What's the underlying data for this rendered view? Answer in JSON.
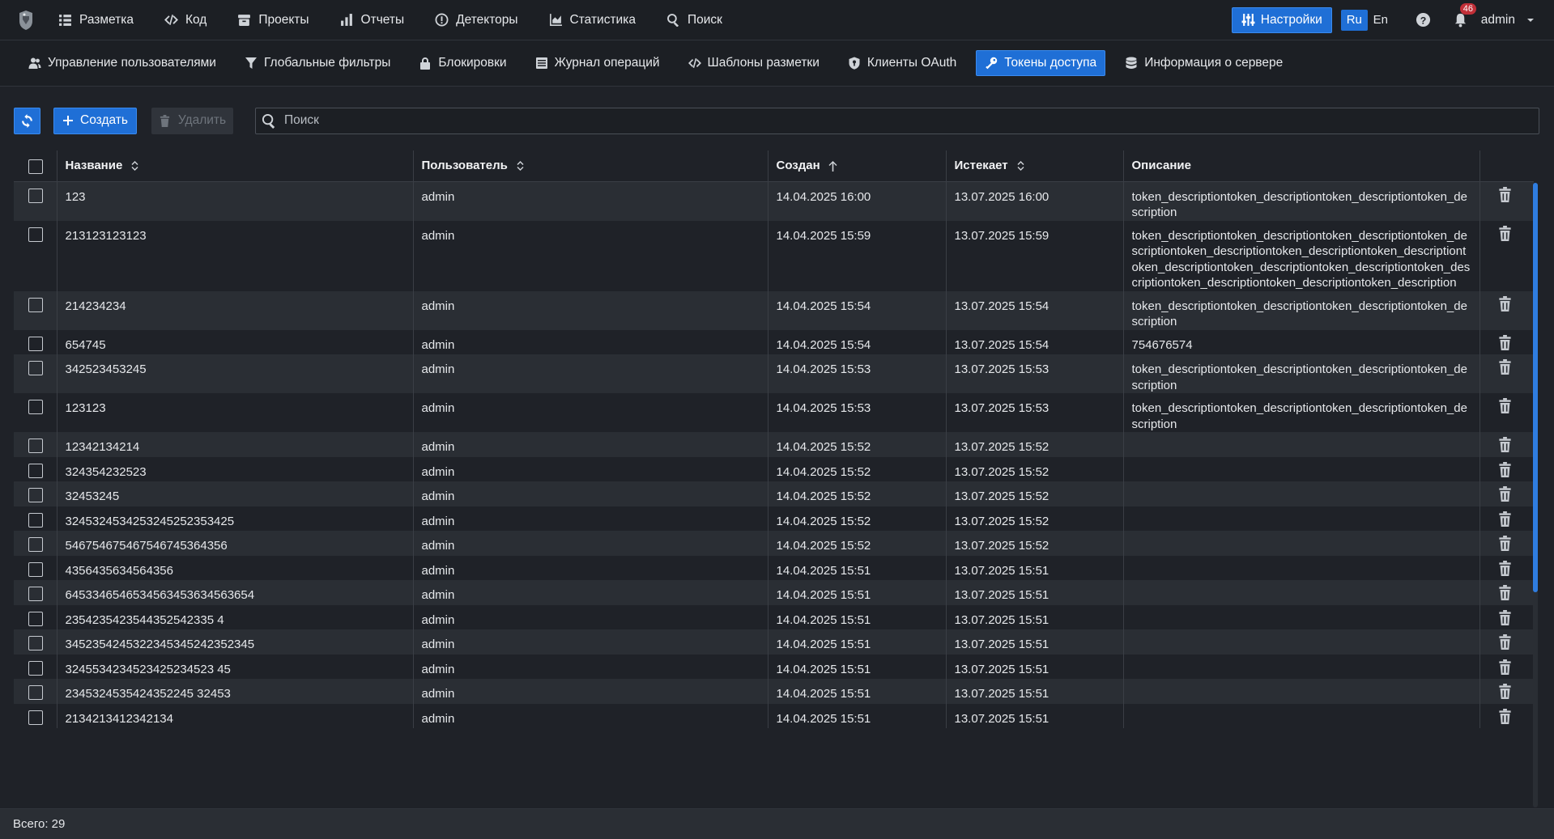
{
  "topnav": {
    "items": [
      {
        "label": "Разметка",
        "icon": "list-icon"
      },
      {
        "label": "Код",
        "icon": "code-icon"
      },
      {
        "label": "Проекты",
        "icon": "archive-icon"
      },
      {
        "label": "Отчеты",
        "icon": "chart-icon"
      },
      {
        "label": "Детекторы",
        "icon": "alert-circle-icon"
      },
      {
        "label": "Статистика",
        "icon": "area-chart-icon"
      },
      {
        "label": "Поиск",
        "icon": "search-icon"
      }
    ],
    "settings_label": "Настройки",
    "lang_ru": "Ru",
    "lang_en": "En",
    "notifications_count": "46",
    "user": "admin"
  },
  "subnav": {
    "items": [
      {
        "label": "Управление пользователями",
        "icon": "users-icon"
      },
      {
        "label": "Глобальные фильтры",
        "icon": "filter-icon"
      },
      {
        "label": "Блокировки",
        "icon": "lock-icon"
      },
      {
        "label": "Журнал операций",
        "icon": "journal-icon"
      },
      {
        "label": "Шаблоны разметки",
        "icon": "code-icon"
      },
      {
        "label": "Клиенты OAuth",
        "icon": "shield-icon"
      },
      {
        "label": "Токены доступа",
        "icon": "key-icon",
        "active": true
      },
      {
        "label": "Информация о сервере",
        "icon": "database-icon"
      }
    ]
  },
  "toolbar": {
    "create_label": "Создать",
    "delete_label": "Удалить",
    "search_placeholder": "Поиск"
  },
  "table": {
    "headers": {
      "name": "Название",
      "user": "Пользователь",
      "created": "Создан",
      "expires": "Истекает",
      "description": "Описание"
    },
    "rows": [
      {
        "name": "123",
        "user": "admin",
        "created": "14.04.2025 16:00",
        "expires": "13.07.2025 16:00",
        "description": "token_descriptiontoken_descriptiontoken_descriptiontoken_description"
      },
      {
        "name": "213123123123",
        "user": "admin",
        "created": "14.04.2025 15:59",
        "expires": "13.07.2025 15:59",
        "description": "token_descriptiontoken_descriptiontoken_descriptiontoken_descriptiontoken_descriptiontoken_descriptiontoken_descriptiontoken_descriptiontoken_descriptiontoken_descriptiontoken_descriptiontoken_descriptiontoken_descriptiontoken_description"
      },
      {
        "name": "214234234",
        "user": "admin",
        "created": "14.04.2025 15:54",
        "expires": "13.07.2025 15:54",
        "description": "token_descriptiontoken_descriptiontoken_descriptiontoken_description"
      },
      {
        "name": "654745",
        "user": "admin",
        "created": "14.04.2025 15:54",
        "expires": "13.07.2025 15:54",
        "description": "754676574"
      },
      {
        "name": "342523453245",
        "user": "admin",
        "created": "14.04.2025 15:53",
        "expires": "13.07.2025 15:53",
        "description": "token_descriptiontoken_descriptiontoken_descriptiontoken_description"
      },
      {
        "name": "123123",
        "user": "admin",
        "created": "14.04.2025 15:53",
        "expires": "13.07.2025 15:53",
        "description": "token_descriptiontoken_descriptiontoken_descriptiontoken_description"
      },
      {
        "name": "12342134214",
        "user": "admin",
        "created": "14.04.2025 15:52",
        "expires": "13.07.2025 15:52",
        "description": ""
      },
      {
        "name": "324354232523",
        "user": "admin",
        "created": "14.04.2025 15:52",
        "expires": "13.07.2025 15:52",
        "description": ""
      },
      {
        "name": "32453245",
        "user": "admin",
        "created": "14.04.2025 15:52",
        "expires": "13.07.2025 15:52",
        "description": ""
      },
      {
        "name": "3245324534253245252353425",
        "user": "admin",
        "created": "14.04.2025 15:52",
        "expires": "13.07.2025 15:52",
        "description": ""
      },
      {
        "name": "546754675467546745364356",
        "user": "admin",
        "created": "14.04.2025 15:52",
        "expires": "13.07.2025 15:52",
        "description": ""
      },
      {
        "name": "4356435634564356",
        "user": "admin",
        "created": "14.04.2025 15:51",
        "expires": "13.07.2025 15:51",
        "description": ""
      },
      {
        "name": "6453346546534563453634563654",
        "user": "admin",
        "created": "14.04.2025 15:51",
        "expires": "13.07.2025 15:51",
        "description": ""
      },
      {
        "name": "2354235423544352542335 4",
        "user": "admin",
        "created": "14.04.2025 15:51",
        "expires": "13.07.2025 15:51",
        "description": ""
      },
      {
        "name": "3452354245322345345242352345",
        "user": "admin",
        "created": "14.04.2025 15:51",
        "expires": "13.07.2025 15:51",
        "description": ""
      },
      {
        "name": "3245534234523425234523 45",
        "user": "admin",
        "created": "14.04.2025 15:51",
        "expires": "13.07.2025 15:51",
        "description": ""
      },
      {
        "name": "2345324535424352245 32453",
        "user": "admin",
        "created": "14.04.2025 15:51",
        "expires": "13.07.2025 15:51",
        "description": ""
      },
      {
        "name": "2134213412342134",
        "user": "admin",
        "created": "14.04.2025 15:51",
        "expires": "13.07.2025 15:51",
        "description": ""
      }
    ]
  },
  "footer": {
    "total_label": "Всего: 29"
  }
}
